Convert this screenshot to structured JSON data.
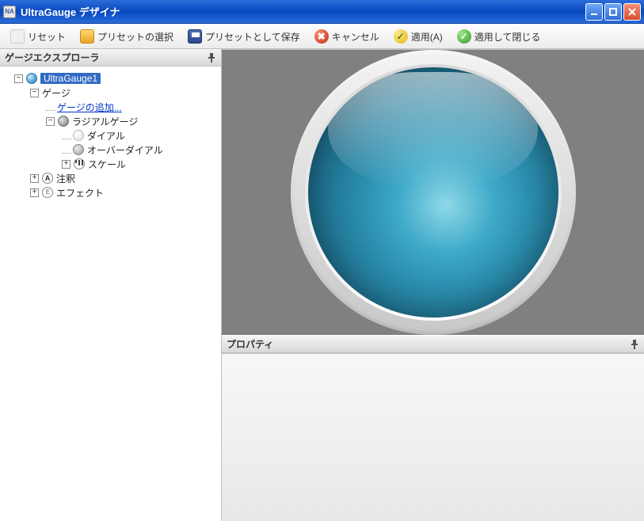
{
  "titlebar": {
    "icon_text": "NA",
    "title_bold": "UltraGauge",
    "title_rest": " デザイナ"
  },
  "toolbar": {
    "reset": "リセット",
    "select_preset": "プリセットの選択",
    "save_preset": "プリセットとして保存",
    "cancel": "キャンセル",
    "apply": "適用(A)",
    "apply_close": "適用して閉じる"
  },
  "explorer": {
    "header": "ゲージエクスプローラ",
    "root": "UltraGauge1",
    "gauge": "ゲージ",
    "add_gauge": "ゲージの追加...",
    "radial_gauge": "ラジアルゲージ",
    "dial": "ダイアル",
    "over_dial": "オーバーダイアル",
    "scale": "スケール",
    "annotation": "注釈",
    "effect": "エフェクト",
    "expand_minus": "−",
    "expand_plus": "+"
  },
  "properties": {
    "header": "プロパティ"
  },
  "icons": {
    "cancel_glyph": "✖",
    "check_glyph": "✓",
    "pin_glyph": "📌",
    "annotation_glyph": "A",
    "effect_glyph": "E"
  }
}
